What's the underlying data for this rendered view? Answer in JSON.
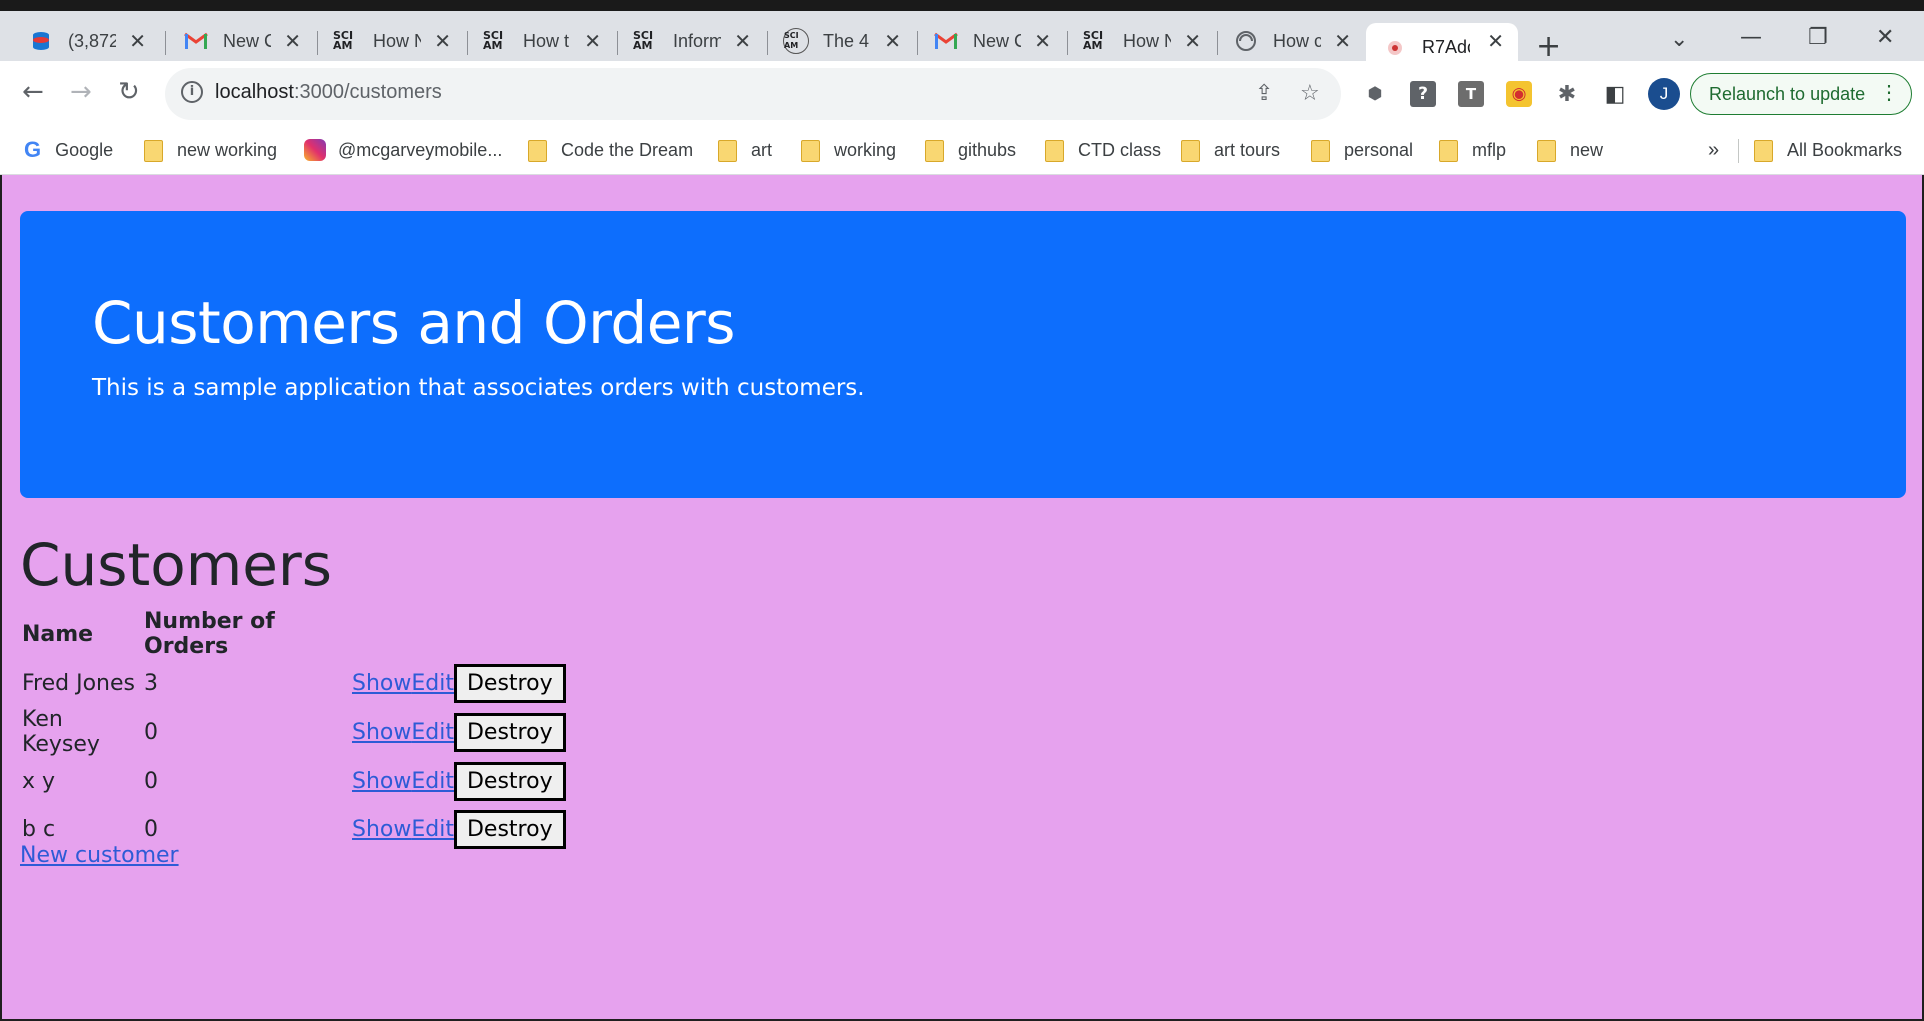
{
  "browser": {
    "tabs": [
      {
        "title": "(3,872",
        "icon": "database-icon"
      },
      {
        "title": "New C",
        "icon": "gmail-icon"
      },
      {
        "title": "How N",
        "icon": "sciam-icon"
      },
      {
        "title": "How t",
        "icon": "sciam-icon"
      },
      {
        "title": "Inform",
        "icon": "sciam-icon"
      },
      {
        "title": "The 4",
        "icon": "sciam-icon"
      },
      {
        "title": "New C",
        "icon": "gmail-icon"
      },
      {
        "title": "How N",
        "icon": "sciam-icon"
      },
      {
        "title": "How c",
        "icon": "globe-icon"
      },
      {
        "title": "R7Adc",
        "icon": "rails-icon",
        "active": true
      }
    ],
    "sciam_label": "SCI AM",
    "url_host": "localhost",
    "url_path": ":3000/customers",
    "relaunch_label": "Relaunch to update",
    "avatar_letter": "J",
    "bookmarks": [
      {
        "label": "Google",
        "type": "google"
      },
      {
        "label": "new working",
        "type": "folder"
      },
      {
        "label": "@mcgarveymobile...",
        "type": "instagram"
      },
      {
        "label": "Code the Dream",
        "type": "folder"
      },
      {
        "label": "art",
        "type": "folder"
      },
      {
        "label": "working",
        "type": "folder"
      },
      {
        "label": "githubs",
        "type": "folder"
      },
      {
        "label": "CTD class",
        "type": "folder"
      },
      {
        "label": "art tours",
        "type": "folder"
      },
      {
        "label": "personal",
        "type": "folder"
      },
      {
        "label": "mflp",
        "type": "folder"
      },
      {
        "label": "new",
        "type": "folder"
      }
    ],
    "overflow_label": "»",
    "all_bookmarks_label": "All Bookmarks"
  },
  "page": {
    "banner_title": "Customers and Orders",
    "banner_subtitle": "This is a sample application that associates orders with customers.",
    "banner_color": "#0d6efd",
    "background_color": "#e6a2ee",
    "heading": "Customers",
    "table": {
      "headers": [
        "Name",
        "Number of Orders"
      ],
      "rows": [
        {
          "name": "Fred Jones",
          "orders": "3"
        },
        {
          "name": "Ken Keysey",
          "orders": "0"
        },
        {
          "name": "x y",
          "orders": "0"
        },
        {
          "name": "b c",
          "orders": "0"
        }
      ],
      "show_label": "Show",
      "edit_label": "Edit",
      "destroy_label": "Destroy"
    },
    "new_customer_label": "New customer"
  }
}
